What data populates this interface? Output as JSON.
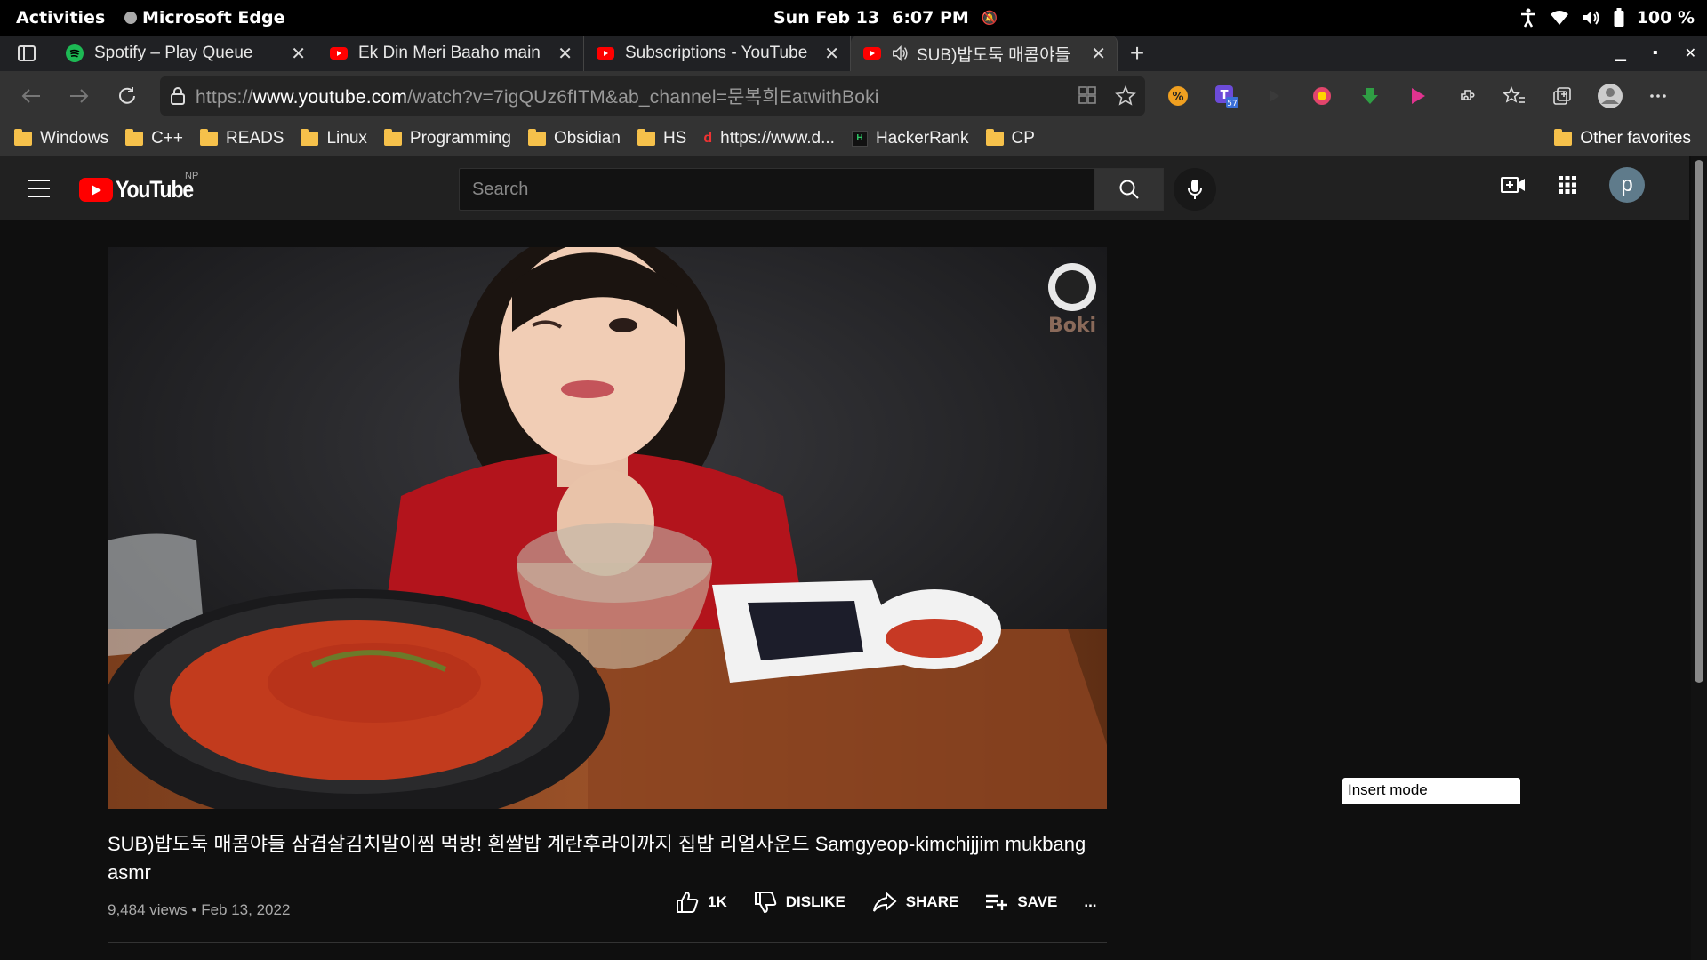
{
  "topbar": {
    "activities": "Activities",
    "app": "Microsoft Edge",
    "date": "Sun Feb 13",
    "time": "6:07 PM",
    "battery": "100 %"
  },
  "tabs": [
    {
      "title": "Spotify – Play Queue",
      "icon": "spotify-icon"
    },
    {
      "title": "Ek Din Meri Baaho main",
      "icon": "youtube-icon"
    },
    {
      "title": "Subscriptions - YouTube",
      "icon": "youtube-icon"
    },
    {
      "title": "SUB)밥도둑 매콤야들",
      "icon": "youtube-icon",
      "active": true,
      "audio": true
    }
  ],
  "address": {
    "prefix": "https://",
    "host": "www.youtube.com",
    "path": "/watch?v=7igQUz6fITM&ab_channel=문복희EatwithBoki"
  },
  "extensions": {
    "badge": "57"
  },
  "favorites": [
    {
      "label": "Windows",
      "type": "folder"
    },
    {
      "label": "C++",
      "type": "folder"
    },
    {
      "label": "READS",
      "type": "folder"
    },
    {
      "label": "Linux",
      "type": "folder"
    },
    {
      "label": "Programming",
      "type": "folder"
    },
    {
      "label": "Obsidian",
      "type": "folder"
    },
    {
      "label": "HS",
      "type": "folder"
    },
    {
      "label": "https://www.d...",
      "type": "link"
    },
    {
      "label": "HackerRank",
      "type": "link"
    },
    {
      "label": "CP",
      "type": "folder"
    }
  ],
  "other_favorites": "Other favorites",
  "youtube": {
    "logo": "YouTube",
    "region": "NP",
    "search_placeholder": "Search",
    "avatar_letter": "p",
    "watermark": "Boki",
    "video_title": "SUB)밥도둑 매콤야들 삼겹살김치말이찜 먹방! 흰쌀밥 계란후라이까지 집밥 리얼사운드 Samgyeop-kimchijjim mukbang asmr",
    "views": "9,484 views",
    "date": "Feb 13, 2022",
    "likes": "1K",
    "dislike": "DISLIKE",
    "share": "SHARE",
    "save": "SAVE",
    "more": "..."
  },
  "status": "Insert mode",
  "colors": {
    "yt_red": "#ff0000",
    "folder": "#f6c14b",
    "background": "#0f0f0f"
  }
}
